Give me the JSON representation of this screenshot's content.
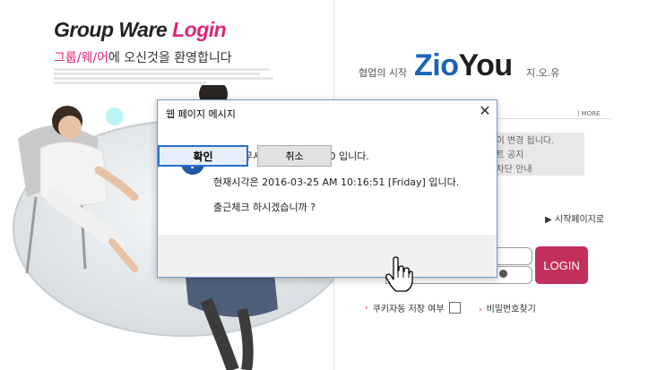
{
  "left": {
    "title_part1": "Group Ware ",
    "title_part2": "Login",
    "welcome_part1": "그룹/웨/어",
    "welcome_part2": "에 오신것을 환영합니다"
  },
  "right": {
    "slogan": "협업의 시작",
    "logo_part1": "Zio",
    "logo_part2": "You",
    "logo_kr": "지.오.유",
    "more": "| MORE",
    "notices": [
      "...이 변경 됩니다.",
      "...트 공지",
      "...차단 안내"
    ],
    "start_link": "▶ 시작페이지로",
    "login_button": "LOGIN",
    "cookie_label": "쿠키자동 저장 여부",
    "find_password": "비밀번호찾기"
  },
  "dialog": {
    "title": "웹 페이지 메시지",
    "close_glyph": "✕",
    "icon_glyph": "?",
    "line1": "오늘 근무시간은 8:40~18:0 입니다.",
    "line2": "현재시각은 2016-03-25 AM 10:16:51 [Friday] 입니다.",
    "line3": "출근체크 하시겠습니까 ?",
    "ok_label": "확인",
    "cancel_label": "취소"
  },
  "colors": {
    "accent_pink": "#e0257a",
    "login_button": "#c4305d",
    "logo_blue": "#1b63b6",
    "dialog_border": "#6f9ac7",
    "dialog_icon": "#1f5aa8"
  }
}
